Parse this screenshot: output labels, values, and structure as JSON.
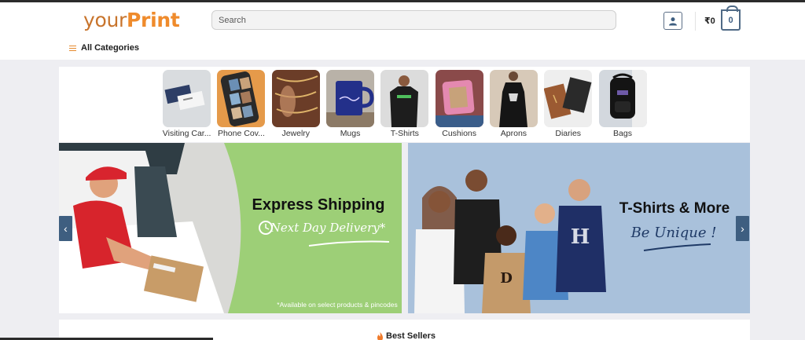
{
  "brand": {
    "part1": "your",
    "part2": "Print"
  },
  "search": {
    "placeholder": "Search"
  },
  "header": {
    "cart_total": "₹0",
    "cart_count": "0",
    "all_categories": "All Categories"
  },
  "categories": [
    {
      "label": "Visiting Car...",
      "icon": "visiting-cards-icon"
    },
    {
      "label": "Phone Cov...",
      "icon": "phone-cover-icon"
    },
    {
      "label": "Jewelry",
      "icon": "jewelry-icon"
    },
    {
      "label": "Mugs",
      "icon": "mug-icon"
    },
    {
      "label": "T-Shirts",
      "icon": "tshirt-icon"
    },
    {
      "label": "Cushions",
      "icon": "cushion-icon"
    },
    {
      "label": "Aprons",
      "icon": "apron-icon"
    },
    {
      "label": "Diaries",
      "icon": "diary-icon"
    },
    {
      "label": "Bags",
      "icon": "bag-icon"
    }
  ],
  "banners": {
    "left": {
      "title": "Express Shipping",
      "subtitle": "Next Day Delivery*",
      "note": "*Available on select products & pincodes"
    },
    "right": {
      "title": "T-Shirts & More",
      "subtitle": "Be Unique !"
    }
  },
  "sections": {
    "best_sellers": "Best Sellers"
  },
  "colors": {
    "brand_orange": "#ef8b2c",
    "nav_blue": "#3e5e80",
    "banner_green": "#9ccd74",
    "banner_blue": "#aac2dc"
  }
}
